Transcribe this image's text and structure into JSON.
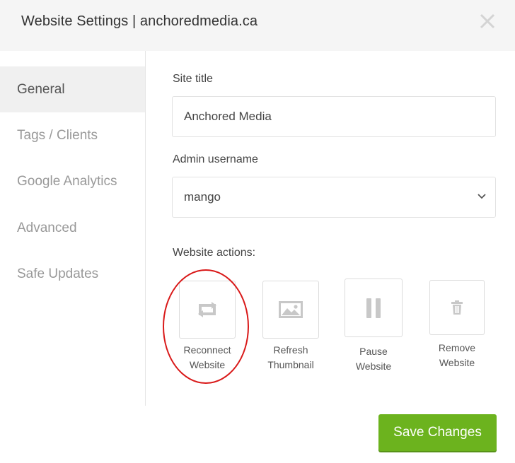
{
  "header": {
    "title": "Website Settings | anchoredmedia.ca",
    "close_icon": "close-icon"
  },
  "sidebar": {
    "items": [
      {
        "label": "General",
        "active": true
      },
      {
        "label": "Tags / Clients",
        "active": false
      },
      {
        "label": "Google Analytics",
        "active": false
      },
      {
        "label": "Advanced",
        "active": false
      },
      {
        "label": "Safe Updates",
        "active": false
      }
    ]
  },
  "form": {
    "site_title_label": "Site title",
    "site_title_value": "Anchored Media",
    "admin_username_label": "Admin username",
    "admin_username_value": "mango",
    "website_actions_label": "Website actions:"
  },
  "actions": [
    {
      "line1": "Reconnect",
      "line2": "Website",
      "icon": "reconnect-icon"
    },
    {
      "line1": "Refresh",
      "line2": "Thumbnail",
      "icon": "image-icon"
    },
    {
      "line1": "Pause",
      "line2": "Website",
      "icon": "pause-icon"
    },
    {
      "line1": "Remove",
      "line2": "Website",
      "icon": "trash-icon"
    }
  ],
  "footer": {
    "save_label": "Save Changes"
  },
  "colors": {
    "accent": "#6cb31e",
    "highlight": "#d91919"
  }
}
